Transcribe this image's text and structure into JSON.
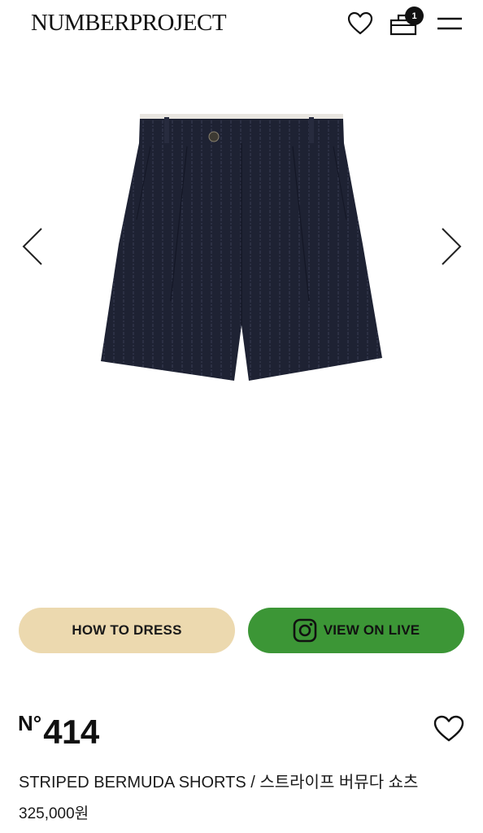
{
  "header": {
    "logo": "NUMBERPROJECT",
    "cart_count": "1",
    "icons": [
      "heart-icon",
      "shopping-bag-icon",
      "hamburger-menu-icon"
    ]
  },
  "gallery": {
    "image": "navy pinstripe bermuda shorts",
    "prev_icon": "chevron-left-icon",
    "next_icon": "chevron-right-icon"
  },
  "actions": {
    "how_to_dress": "HOW TO DRESS",
    "view_on_live": "VIEW ON LIVE",
    "live_icon": "instagram-icon"
  },
  "product": {
    "number_prefix": "N°",
    "number": "414",
    "name": "STRIPED BERMUDA SHORTS / 스트라이프 버뮤다 쇼츠",
    "price": "325,000원"
  },
  "colors": {
    "how_to_dress_bg": "#ecd9af",
    "view_on_live_bg": "#3c9636",
    "shorts_navy": "#1e2233"
  }
}
